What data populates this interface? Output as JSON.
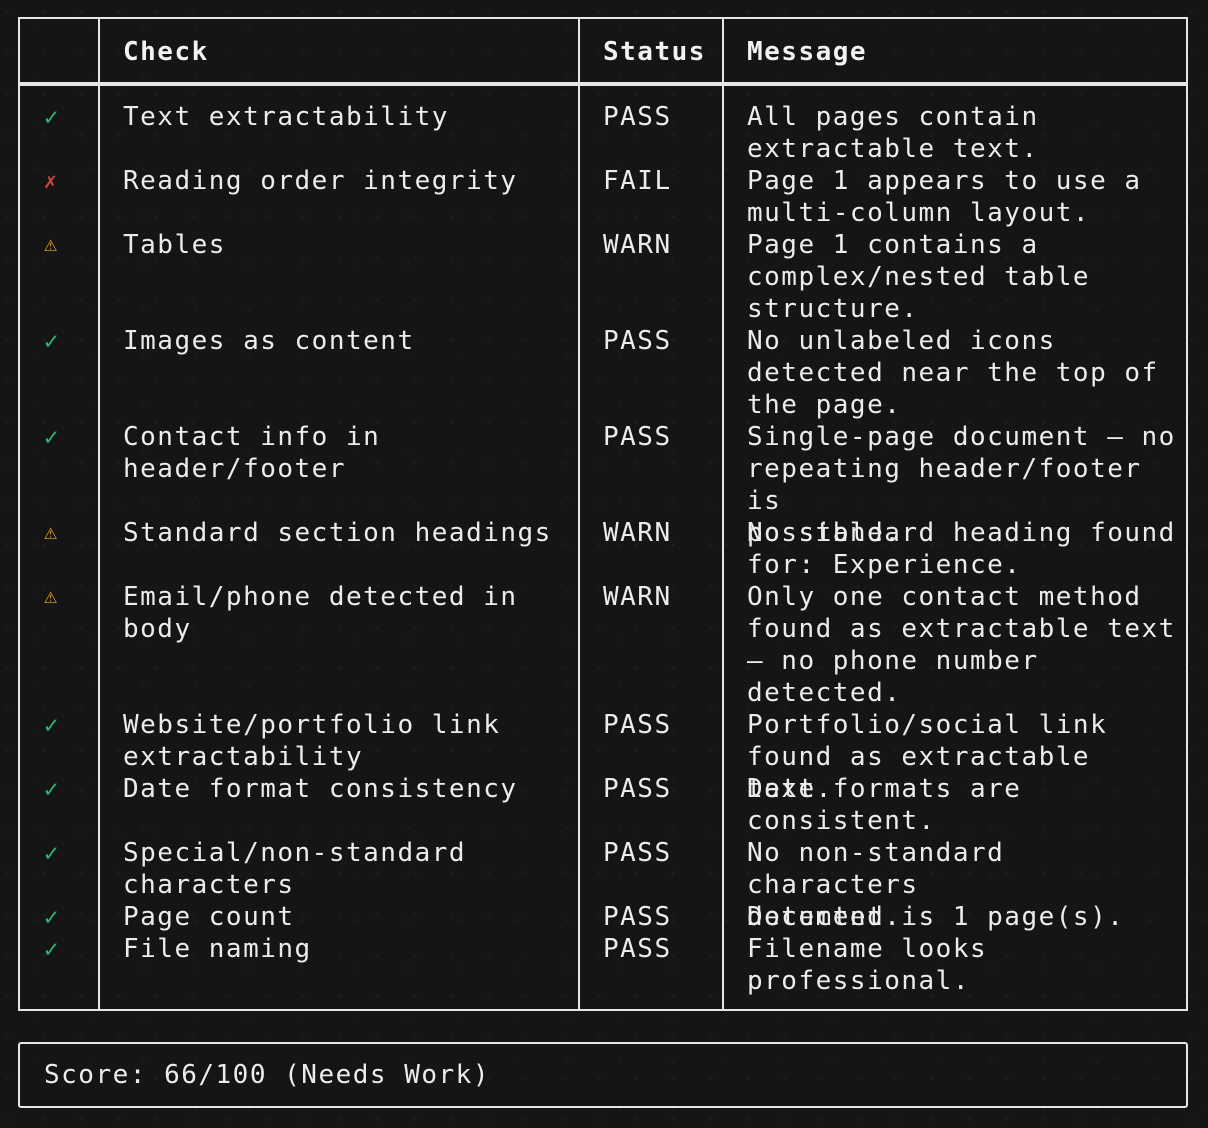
{
  "table": {
    "headers": {
      "icon": "",
      "check": "Check",
      "status": "Status",
      "message": "Message"
    },
    "rows": [
      {
        "icon": "check-icon",
        "glyph": "✓",
        "kind": "pass",
        "check": "Text extractability",
        "status": "PASS",
        "message": "All pages contain\nextractable text."
      },
      {
        "icon": "cross-icon",
        "glyph": "✗",
        "kind": "fail",
        "check": "Reading order integrity",
        "status": "FAIL",
        "message": "Page 1 appears to use a\nmulti-column layout."
      },
      {
        "icon": "warning-icon",
        "glyph": "⚠",
        "kind": "warn",
        "check": "Tables",
        "status": "WARN",
        "message": "Page 1 contains a\ncomplex/nested table\nstructure."
      },
      {
        "icon": "check-icon",
        "glyph": "✓",
        "kind": "pass",
        "check": "Images as content",
        "status": "PASS",
        "message": "No unlabeled icons\ndetected near the top of\nthe page."
      },
      {
        "icon": "check-icon",
        "glyph": "✓",
        "kind": "pass",
        "check": "Contact info in\nheader/footer",
        "status": "PASS",
        "message": "Single-page document — no\nrepeating header/footer is\npossible."
      },
      {
        "icon": "warning-icon",
        "glyph": "⚠",
        "kind": "warn",
        "check": "Standard section headings",
        "status": "WARN",
        "message": "No standard heading found\nfor: Experience."
      },
      {
        "icon": "warning-icon",
        "glyph": "⚠",
        "kind": "warn",
        "check": "Email/phone detected in\nbody",
        "status": "WARN",
        "message": "Only one contact method\nfound as extractable text\n— no phone number\ndetected."
      },
      {
        "icon": "check-icon",
        "glyph": "✓",
        "kind": "pass",
        "check": "Website/portfolio link\nextractability",
        "status": "PASS",
        "message": "Portfolio/social link\nfound as extractable text."
      },
      {
        "icon": "check-icon",
        "glyph": "✓",
        "kind": "pass",
        "check": "Date format consistency",
        "status": "PASS",
        "message": "Date formats are\nconsistent."
      },
      {
        "icon": "check-icon",
        "glyph": "✓",
        "kind": "pass",
        "check": "Special/non-standard\ncharacters",
        "status": "PASS",
        "message": "No non-standard characters\ndetected."
      },
      {
        "icon": "check-icon",
        "glyph": "✓",
        "kind": "pass",
        "check": "Page count",
        "status": "PASS",
        "message": "Document is 1 page(s)."
      },
      {
        "icon": "check-icon",
        "glyph": "✓",
        "kind": "pass",
        "check": "File naming",
        "status": "PASS",
        "message": "Filename looks\nprofessional."
      }
    ]
  },
  "score": {
    "text": "Score: 66/100 (Needs Work)"
  },
  "colors": {
    "pass": "#2fb66a",
    "fail": "#d9453e",
    "warn": "#e8a62a",
    "border": "#e6e6e6",
    "background": "#151515"
  }
}
